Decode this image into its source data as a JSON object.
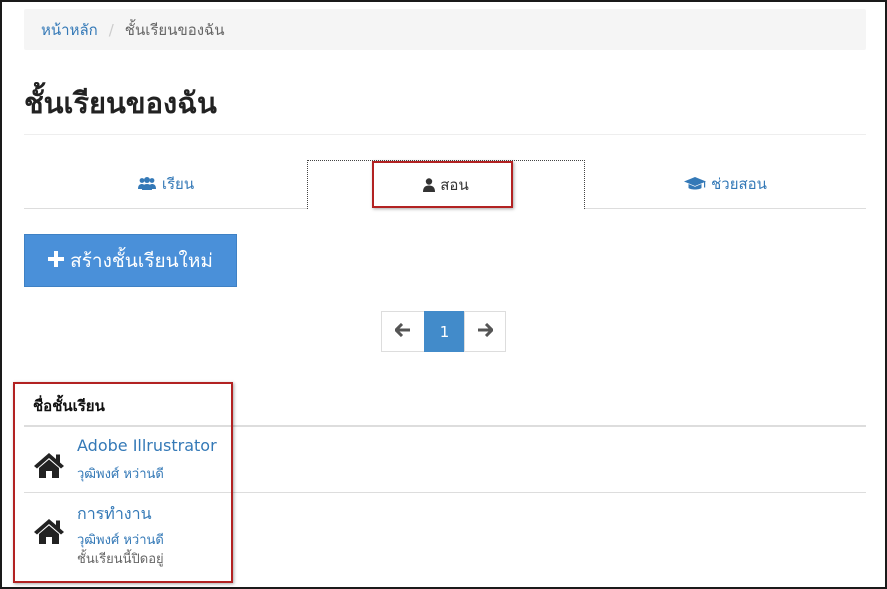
{
  "breadcrumb": {
    "home": "หน้าหลัก",
    "separator": "/",
    "current": "ชั้นเรียนของฉัน"
  },
  "page_title": "ชั้นเรียนของฉัน",
  "tabs": [
    {
      "label": "เรียน",
      "icon": "users-icon",
      "active": false
    },
    {
      "label": "สอน",
      "icon": "user-icon",
      "active": true
    },
    {
      "label": "ช่วยสอน",
      "icon": "graduation-cap-icon",
      "active": false
    }
  ],
  "create_button": {
    "icon": "plus-icon",
    "label": "สร้างชั้นเรียนใหม่"
  },
  "pagination": {
    "prev_icon": "arrow-left-icon",
    "page": "1",
    "next_icon": "arrow-right-icon"
  },
  "list": {
    "header": "ชื่อชั้นเรียน",
    "rows": [
      {
        "icon": "home-icon",
        "name": "Adobe Illrustrator",
        "owner": "วุฒิพงศ์ หว่านดี",
        "status": ""
      },
      {
        "icon": "home-icon",
        "name": "การทำงาน",
        "owner": "วุฒิพงศ์ หว่านดี",
        "status": "ชั้นเรียนนี้ปิดอยู่"
      }
    ]
  },
  "colors": {
    "link": "#3479b7",
    "primary": "#4a90d9",
    "page_active": "#428bca",
    "annotation": "#b22222"
  }
}
